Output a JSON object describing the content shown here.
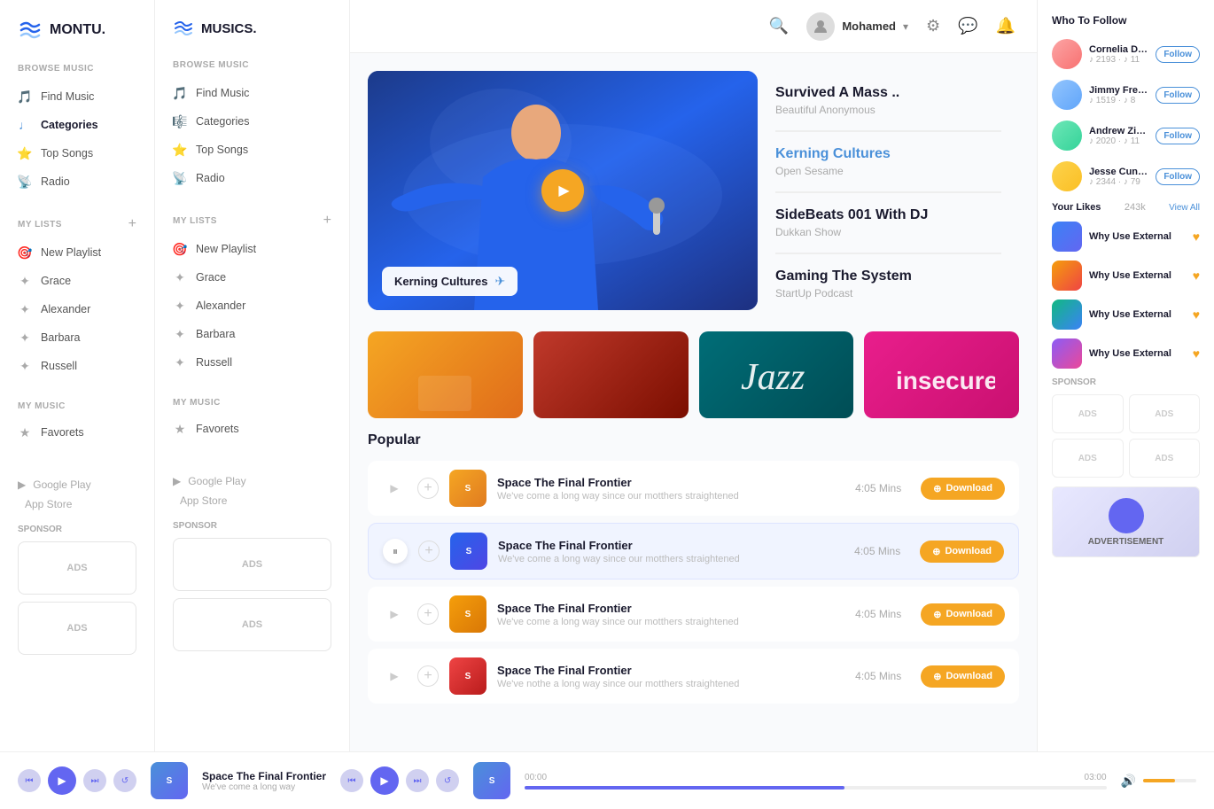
{
  "app": {
    "left_logo": "MONTU.",
    "right_logo": "MUSICS."
  },
  "left_sidebar": {
    "browse_title": "Browse Music",
    "nav_items": [
      {
        "label": "Find Music",
        "icon": "🎵",
        "active": false
      },
      {
        "label": "Categories",
        "icon": "♩",
        "active": true
      },
      {
        "label": "Top Songs",
        "icon": "♪",
        "active": false
      },
      {
        "label": "Radio",
        "icon": "📻",
        "active": false
      }
    ],
    "my_lists_title": "My Lists",
    "my_lists_items": [
      {
        "label": "New Playlist"
      },
      {
        "label": "Grace"
      },
      {
        "label": "Alexander"
      },
      {
        "label": "Barbara"
      },
      {
        "label": "Russell"
      }
    ],
    "my_music_title": "My Music",
    "my_music_items": [
      {
        "label": "Favorets"
      }
    ],
    "bottom_links": [
      {
        "label": "Google Play",
        "icon": "▶"
      },
      {
        "label": "App Store",
        "icon": ""
      }
    ],
    "sponsor_title": "Sponsor",
    "ads_label": "ADS"
  },
  "second_sidebar": {
    "browse_title": "Browse Music",
    "nav_items": [
      {
        "label": "Find Music"
      },
      {
        "label": "Categories"
      },
      {
        "label": "Top Songs"
      },
      {
        "label": "Radio"
      }
    ],
    "my_lists_title": "My Lists",
    "my_lists_items": [
      {
        "label": "New Playlist"
      },
      {
        "label": "Grace"
      },
      {
        "label": "Alexander"
      },
      {
        "label": "Barbara"
      },
      {
        "label": "Russell"
      }
    ],
    "my_music_title": "My Music",
    "my_music_items": [
      {
        "label": "Favorets"
      }
    ],
    "bottom_links": [
      {
        "label": "Google Play"
      },
      {
        "label": "App Store"
      }
    ],
    "sponsor_title": "Sponsor",
    "ads_label": "ADS"
  },
  "topbar": {
    "username": "Mohamed",
    "search_placeholder": "Search..."
  },
  "hero": {
    "label": "Kerning Cultures",
    "tracks": [
      {
        "title": "Survived A Mass ..",
        "subtitle": "Beautiful Anonymous",
        "active": false
      },
      {
        "title": "Kerning Cultures",
        "subtitle": "Open Sesame",
        "active": true
      },
      {
        "title": "SideBeats 001 With DJ",
        "subtitle": "Dukkan Show",
        "active": false
      },
      {
        "title": "Gaming The System",
        "subtitle": "StartUp Podcast",
        "active": false
      }
    ]
  },
  "thumbnails": [
    {
      "alt": "thumb1",
      "color": "orange"
    },
    {
      "alt": "thumb2",
      "color": "red"
    },
    {
      "alt": "thumb3",
      "color": "teal"
    },
    {
      "alt": "thumb4",
      "color": "pink"
    }
  ],
  "popular": {
    "title": "Popular",
    "tracks": [
      {
        "name": "Space The Final Frontier",
        "desc": "We've come a long way since our motthers straightened",
        "duration": "4:05",
        "duration_label": "Mins",
        "active": false
      },
      {
        "name": "Space The Final Frontier",
        "desc": "We've come a long way since our motthers straightened",
        "duration": "4:05",
        "duration_label": "Mins",
        "active": true
      },
      {
        "name": "Space The Final Frontier",
        "desc": "We've come a long way since our motthers straightened",
        "duration": "4:05",
        "duration_label": "Mins",
        "active": false
      },
      {
        "name": "Space The Final Frontier",
        "desc": "We've nothe a long way since our motthers straightened",
        "duration": "4:05",
        "duration_label": "Mins",
        "active": false
      }
    ],
    "download_label": "Download"
  },
  "right_sidebar": {
    "who_follow_title": "Who To Follow",
    "follow_items": [
      {
        "name": "Cornelia Davis",
        "stats": "♪ 2193 · ♪ 11",
        "btn": "Follow"
      },
      {
        "name": "Jimmy French",
        "stats": "♪ 1519 · ♪ 8",
        "btn": "Follow"
      },
      {
        "name": "Andrew Zimmerman",
        "stats": "♪ 2020 · ♪ 11",
        "btn": "Follow"
      },
      {
        "name": "Jesse Cunningham",
        "stats": "♪ 2344 · ♪ 79",
        "btn": "Follow"
      }
    ],
    "your_likes_title": "Your Likes",
    "your_likes_count": "243k",
    "view_all": "View All",
    "like_items": [
      {
        "name": "Why Use External"
      },
      {
        "name": "Why Use External"
      },
      {
        "name": "Why Use External"
      },
      {
        "name": "Why Use External"
      }
    ],
    "sponsor_title": "Sponsor",
    "ads_items": [
      "ADS",
      "ADS",
      "ADS",
      "ADS"
    ],
    "advertisement_label": "ADVERTISEMENT"
  },
  "player": {
    "track_name": "Space The Final Frontier",
    "track_sub": "We've come a long way",
    "time_current": "00:00",
    "time_total": "03:00",
    "progress": 55
  }
}
